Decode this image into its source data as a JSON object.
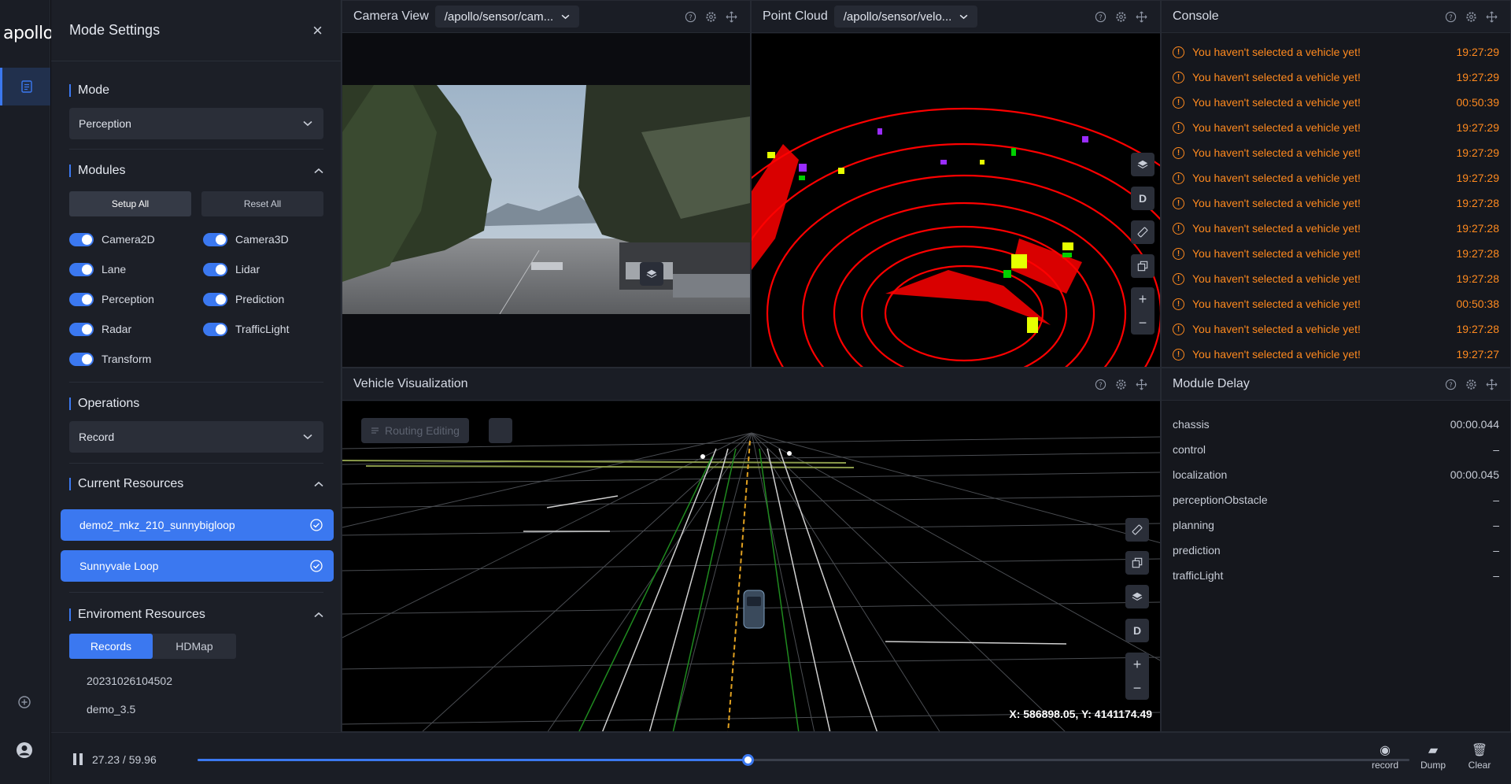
{
  "app": {
    "logo": "apollo"
  },
  "mode_settings": {
    "title": "Mode Settings",
    "close": "×",
    "mode": {
      "title": "Mode",
      "value": "Perception"
    },
    "modules": {
      "title": "Modules",
      "setup_all": "Setup All",
      "reset_all": "Reset All",
      "items": [
        "Camera2D",
        "Camera3D",
        "Lane",
        "Lidar",
        "Perception",
        "Prediction",
        "Radar",
        "TrafficLight",
        "Transform"
      ]
    },
    "operations": {
      "title": "Operations",
      "value": "Record"
    },
    "current_resources": {
      "title": "Current Resources",
      "items": [
        "demo2_mkz_210_sunnybigloop",
        "Sunnyvale Loop"
      ]
    },
    "environment_resources": {
      "title": "Enviroment Resources",
      "tabs": [
        "Records",
        "HDMap"
      ],
      "records": [
        "20231026104502",
        "demo_3.5"
      ]
    }
  },
  "camera_view": {
    "title": "Camera View",
    "channel": "/apollo/sensor/cam..."
  },
  "point_cloud": {
    "title": "Point Cloud",
    "channel": "/apollo/sensor/velo...",
    "d_label": "D"
  },
  "console": {
    "title": "Console",
    "rows": [
      {
        "msg": "You haven't selected a vehicle yet!",
        "time": "19:27:29"
      },
      {
        "msg": "You haven't selected a vehicle yet!",
        "time": "19:27:29"
      },
      {
        "msg": "You haven't selected a vehicle yet!",
        "time": "00:50:39"
      },
      {
        "msg": "You haven't selected a vehicle yet!",
        "time": "19:27:29"
      },
      {
        "msg": "You haven't selected a vehicle yet!",
        "time": "19:27:29"
      },
      {
        "msg": "You haven't selected a vehicle yet!",
        "time": "19:27:29"
      },
      {
        "msg": "You haven't selected a vehicle yet!",
        "time": "19:27:28"
      },
      {
        "msg": "You haven't selected a vehicle yet!",
        "time": "19:27:28"
      },
      {
        "msg": "You haven't selected a vehicle yet!",
        "time": "19:27:28"
      },
      {
        "msg": "You haven't selected a vehicle yet!",
        "time": "19:27:28"
      },
      {
        "msg": "You haven't selected a vehicle yet!",
        "time": "00:50:38"
      },
      {
        "msg": "You haven't selected a vehicle yet!",
        "time": "19:27:28"
      },
      {
        "msg": "You haven't selected a vehicle yet!",
        "time": "19:27:27"
      }
    ]
  },
  "vehicle_viz": {
    "title": "Vehicle Visualization",
    "routing": "Routing Editing",
    "coords": "X: 586898.05, Y: 4141174.49",
    "d_label": "D"
  },
  "module_delay": {
    "title": "Module Delay",
    "rows": [
      {
        "name": "chassis",
        "value": "00:00.044"
      },
      {
        "name": "control",
        "value": "–"
      },
      {
        "name": "localization",
        "value": "00:00.045"
      },
      {
        "name": "perceptionObstacle",
        "value": "–"
      },
      {
        "name": "planning",
        "value": "–"
      },
      {
        "name": "prediction",
        "value": "–"
      },
      {
        "name": "trafficLight",
        "value": "–"
      }
    ]
  },
  "playback": {
    "time": "27.23 / 59.96",
    "current": 27.23,
    "total": 59.96,
    "record": "record",
    "dump": "Dump",
    "clear": "Clear"
  },
  "colors": {
    "accent": "#3b78f0",
    "warning": "#ff8a1f",
    "lidar": "#ff0000"
  }
}
